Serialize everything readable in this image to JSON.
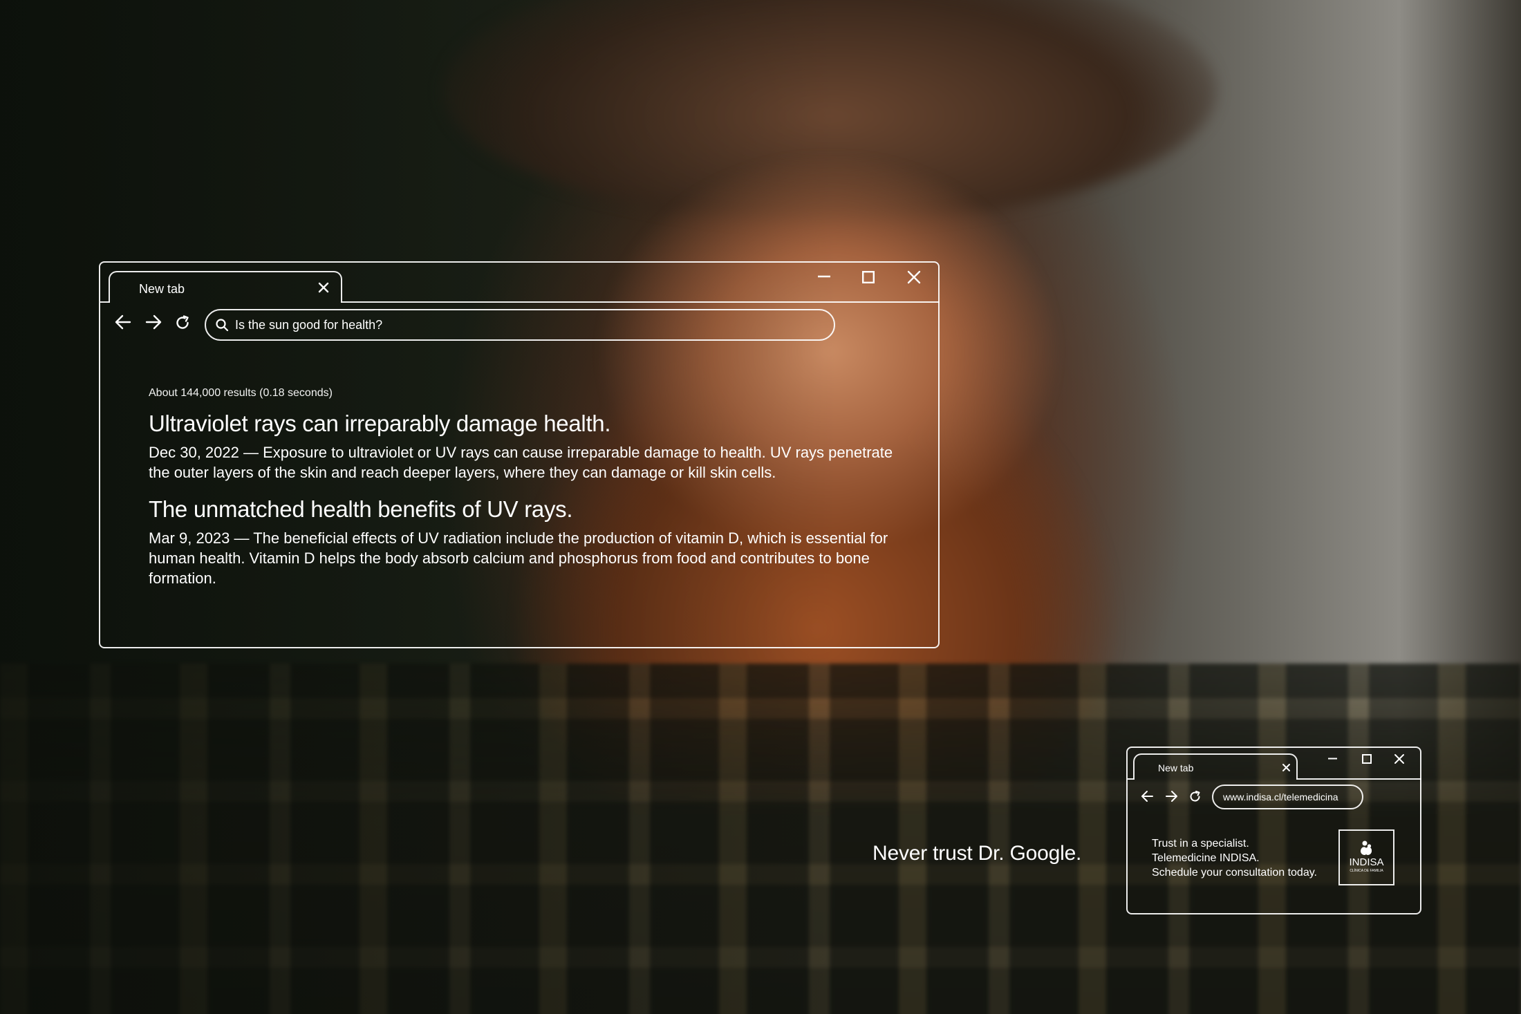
{
  "main_window": {
    "tab_label": "New tab",
    "search_query": "Is the sun good for health?",
    "result_count": "About 144,000 results (0.18 seconds)",
    "results": [
      {
        "title": "Ultraviolet rays can irreparably damage health.",
        "snippet": "Dec 30, 2022 — Exposure to ultraviolet or UV rays can cause irreparable damage to health. UV rays penetrate the outer layers of the skin and reach deeper layers, where they can damage or kill skin cells."
      },
      {
        "title": "The unmatched health benefits of UV rays.",
        "snippet": "Mar 9, 2023 — The beneficial effects of UV radiation include the production of vitamin D, which is essential for human health. Vitamin D helps the body absorb calcium and phosphorus from food and contributes to bone formation."
      }
    ]
  },
  "tagline": "Never trust Dr. Google.",
  "small_window": {
    "tab_label": "New tab",
    "url": "www.indisa.cl/telemedicina",
    "promo_lines": [
      "Trust in a specialist.",
      "Telemedicine INDISA.",
      "Schedule your consultation today."
    ],
    "logo": {
      "name": "INDISA",
      "subtitle": "CLÍNICA DE FAMILIA"
    }
  },
  "colors": {
    "outline": "#ffffff",
    "text": "#ffffff"
  },
  "icons": [
    "close-icon",
    "minimize-icon",
    "maximize-icon",
    "back-arrow-icon",
    "forward-arrow-icon",
    "reload-icon",
    "search-icon",
    "indisa-logo-icon"
  ]
}
